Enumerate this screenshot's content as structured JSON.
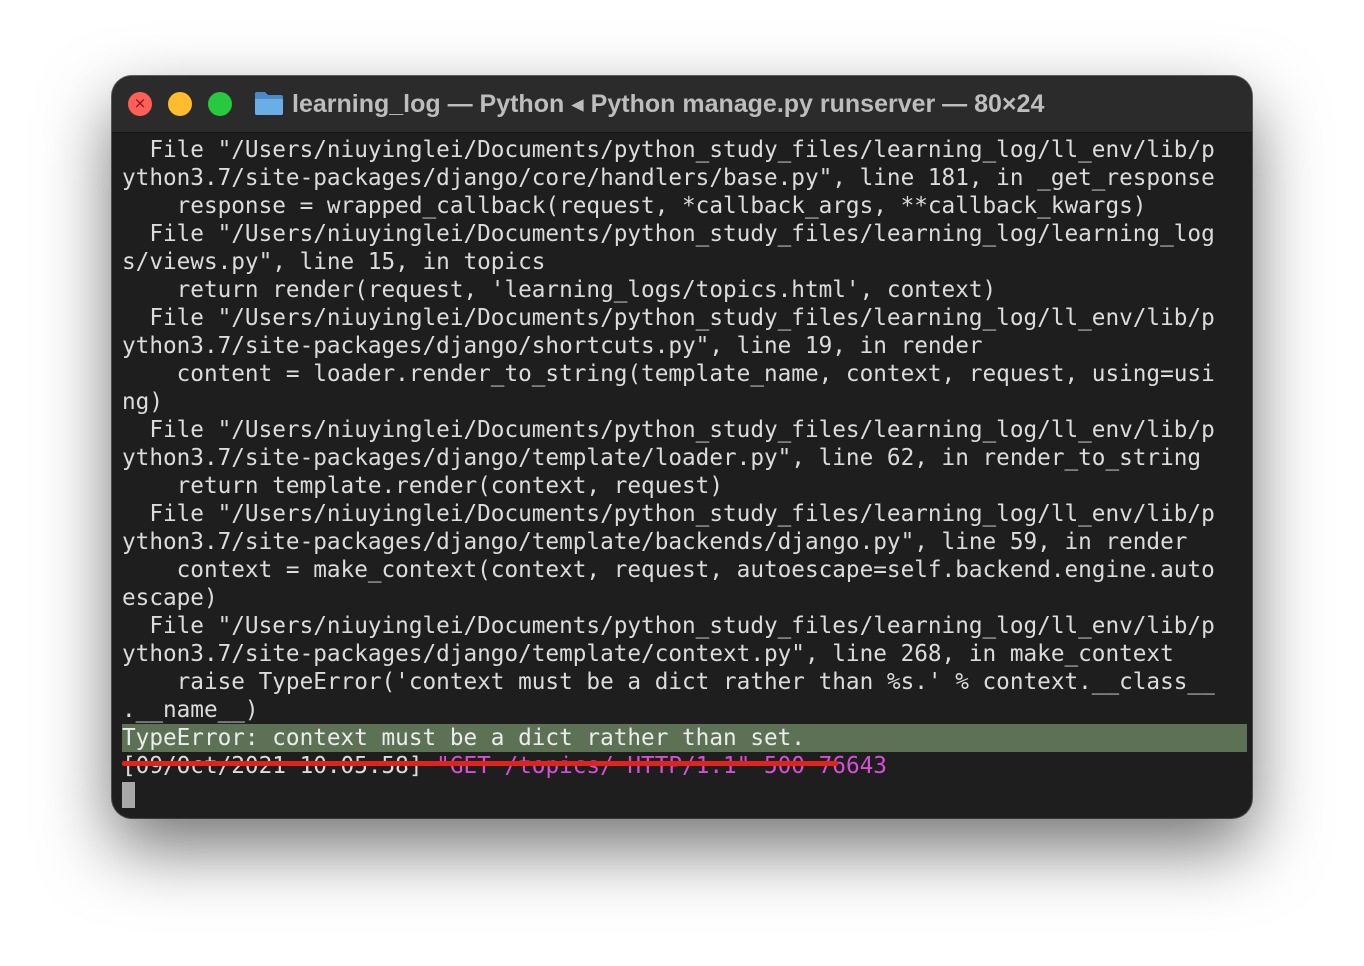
{
  "window": {
    "title": "learning_log — Python ◂ Python manage.py runserver — 80×24",
    "folder_icon": "folder-icon",
    "traffic_lights": {
      "close": {
        "icon": "close-icon",
        "color": "#ff5f57"
      },
      "minimize": {
        "icon": "minimize-icon",
        "color": "#febc2e"
      },
      "zoom": {
        "icon": "zoom-icon",
        "color": "#28c840"
      }
    }
  },
  "terminal": {
    "lines": [
      "  File \"/Users/niuyinglei/Documents/python_study_files/learning_log/ll_env/lib/p",
      "ython3.7/site-packages/django/core/handlers/base.py\", line 181, in _get_response",
      "    response = wrapped_callback(request, *callback_args, **callback_kwargs)",
      "  File \"/Users/niuyinglei/Documents/python_study_files/learning_log/learning_log",
      "s/views.py\", line 15, in topics",
      "    return render(request, 'learning_logs/topics.html', context)",
      "  File \"/Users/niuyinglei/Documents/python_study_files/learning_log/ll_env/lib/p",
      "ython3.7/site-packages/django/shortcuts.py\", line 19, in render",
      "    content = loader.render_to_string(template_name, context, request, using=usi",
      "ng)",
      "  File \"/Users/niuyinglei/Documents/python_study_files/learning_log/ll_env/lib/p",
      "ython3.7/site-packages/django/template/loader.py\", line 62, in render_to_string",
      "    return template.render(context, request)",
      "  File \"/Users/niuyinglei/Documents/python_study_files/learning_log/ll_env/lib/p",
      "ython3.7/site-packages/django/template/backends/django.py\", line 59, in render",
      "    context = make_context(context, request, autoescape=self.backend.engine.auto",
      "escape)",
      "  File \"/Users/niuyinglei/Documents/python_study_files/learning_log/ll_env/lib/p",
      "ython3.7/site-packages/django/template/context.py\", line 268, in make_context",
      "    raise TypeError('context must be a dict rather than %s.' % context.__class__",
      ".__name__)"
    ],
    "error_line": "TypeError: context must be a dict rather than set.",
    "log_line": {
      "timestamp": "[09/Oct/2021 10:05:58] ",
      "request": "\"GET /topics/ HTTP/1.1\" 500 76643"
    },
    "colors": {
      "error_highlight": "#5d7255",
      "request_text": "#d54fd7",
      "underline_mark": "#e0241c"
    }
  }
}
